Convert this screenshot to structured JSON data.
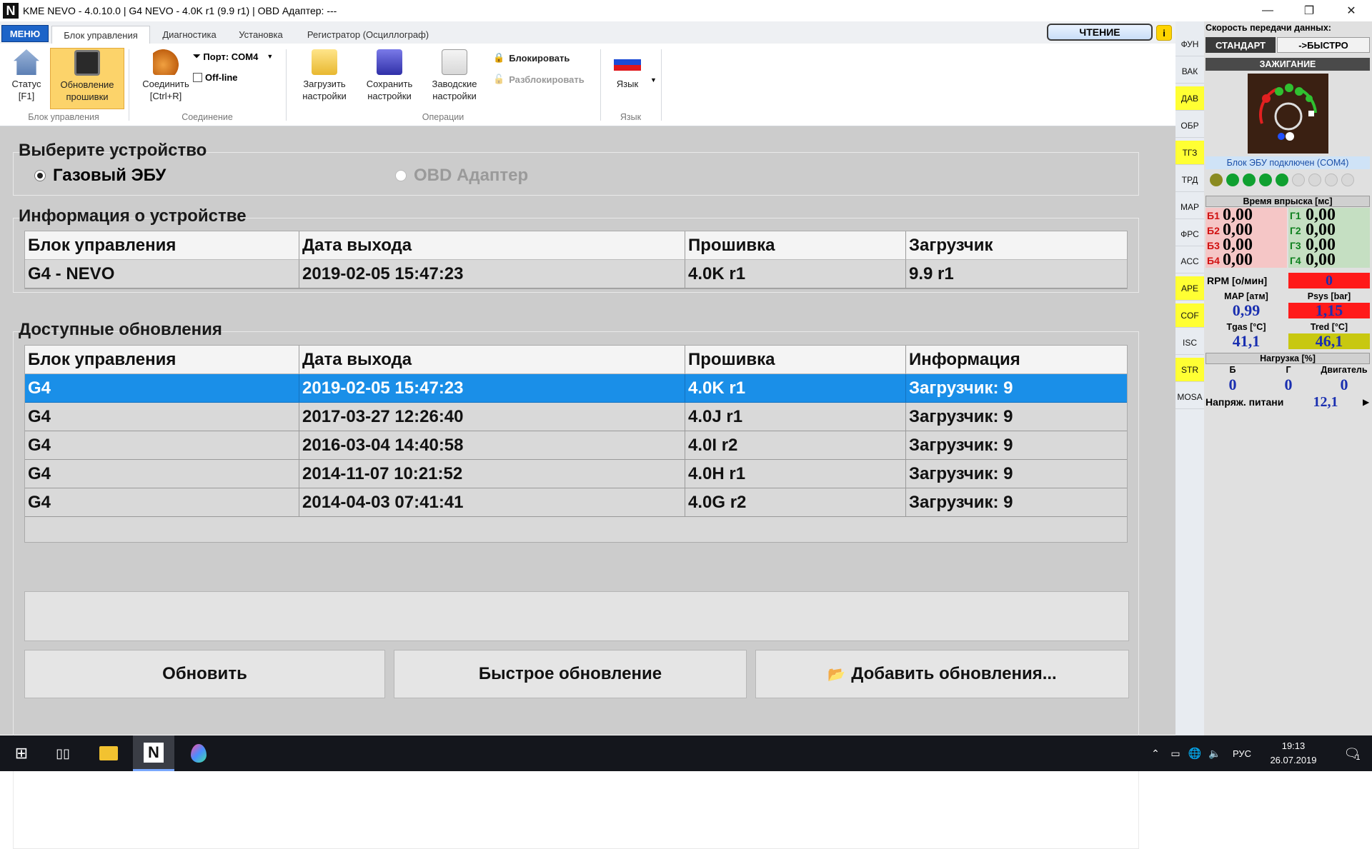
{
  "window": {
    "title": "KME NEVO - 4.0.10.0  |  G4 NEVO - 4.0K r1 (9.9 r1)  |  OBD Адаптер: ---",
    "logo": "N"
  },
  "ribbon": {
    "menu": "МЕНЮ",
    "tabs": [
      "Блок управления",
      "Диагностика",
      "Установка",
      "Регистратор (Осциллограф)"
    ],
    "read_button": "ЧТЕНИЕ",
    "buttons": {
      "status": [
        "Статус",
        "[F1]"
      ],
      "firmware": [
        "Обновление",
        "прошивки"
      ],
      "connect": [
        "Соединить",
        "[Ctrl+R]"
      ],
      "port": "Порт: COM4",
      "offline": "Off-line",
      "load": [
        "Загрузить",
        "настройки"
      ],
      "save": [
        "Сохранить",
        "настройки"
      ],
      "factory": [
        "Заводские",
        "настройки"
      ],
      "lock": "Блокировать",
      "unlock": "Разблокировать",
      "language": "Язык"
    },
    "groups": [
      "Блок управления",
      "Соединение",
      "Операции",
      "Язык"
    ]
  },
  "main": {
    "select_device_title": "Выберите устройство",
    "radio_gas_ecu": "Газовый ЭБУ",
    "radio_obd": "OBD Адаптер",
    "device_info_title": "Информация о устройстве",
    "device_info_headers": [
      "Блок управления",
      "Дата выхода",
      "Прошивка",
      "Загрузчик"
    ],
    "device_info_row": [
      "G4 - NEVO",
      "2019-02-05 15:47:23",
      "4.0K r1",
      "9.9 r1"
    ],
    "updates_title": "Доступные обновления",
    "updates_headers": [
      "Блок управления",
      "Дата выхода",
      "Прошивка",
      "Информация"
    ],
    "updates_rows": [
      [
        "G4",
        "2019-02-05 15:47:23",
        "4.0K r1",
        "Загрузчик: 9"
      ],
      [
        "G4",
        "2017-03-27 12:26:40",
        "4.0J r1",
        "Загрузчик: 9"
      ],
      [
        "G4",
        "2016-03-04 14:40:58",
        "4.0I r2",
        "Загрузчик: 9"
      ],
      [
        "G4",
        "2014-11-07 10:21:52",
        "4.0H r1",
        "Загрузчик: 9"
      ],
      [
        "G4",
        "2014-04-03 07:41:41",
        "4.0G r2",
        "Загрузчик: 9"
      ]
    ],
    "btn_update": "Обновить",
    "btn_fast_update": "Быстрое обновление",
    "btn_add_updates": "Добавить обновления..."
  },
  "side_tabs": [
    "ФУН",
    "ВАК",
    "ДАВ",
    "ОБР",
    "ТГЗ",
    "ТРД",
    "MAP",
    "ФРС",
    "ACC",
    "APE",
    "COF",
    "ISC",
    "STR",
    "MOSA"
  ],
  "right_panel": {
    "speed_title": "Скорость передачи данных:",
    "speed_standard": "СТАНДАРТ",
    "speed_fast": "->БЫСТРО",
    "ignition": "ЗАЖИГАНИЕ",
    "ecu_status": "Блок ЭБУ подключен (COM4)",
    "injection_title": "Время впрыска [мс]",
    "petrol_labels": [
      "Б1",
      "Б2",
      "Б3",
      "Б4"
    ],
    "petrol_values": [
      "0,00",
      "0,00",
      "0,00",
      "0,00"
    ],
    "gas_labels": [
      "Г1",
      "Г2",
      "Г3",
      "Г4"
    ],
    "gas_values": [
      "0,00",
      "0,00",
      "0,00",
      "0,00"
    ],
    "rpm_label": "RPM [о/мин]",
    "rpm_value": "0",
    "map_label": "MAP [атм]",
    "map_value": "0,99",
    "psys_label": "Psys [bar]",
    "psys_value": "1,15",
    "tgas_label": "Tgas [°C]",
    "tgas_value": "41,1",
    "tred_label": "Tred [°C]",
    "tred_value": "46,1",
    "load_title": "Нагрузка [%]",
    "load_labels": [
      "Б",
      "Г",
      "Двигатель"
    ],
    "load_values": [
      "0",
      "0",
      "0"
    ],
    "voltage_label": "Напряж. питани",
    "voltage_value": "12,1"
  },
  "taskbar": {
    "lang": "РУС",
    "time": "19:13",
    "date": "26.07.2019",
    "notifications": "1"
  },
  "colors": {
    "accent": "#1a8fe8",
    "menu": "#1d64c8",
    "yellow_tab": "#ffff33",
    "red_value": "#ff1a1a",
    "taskbar": "#14161c"
  }
}
